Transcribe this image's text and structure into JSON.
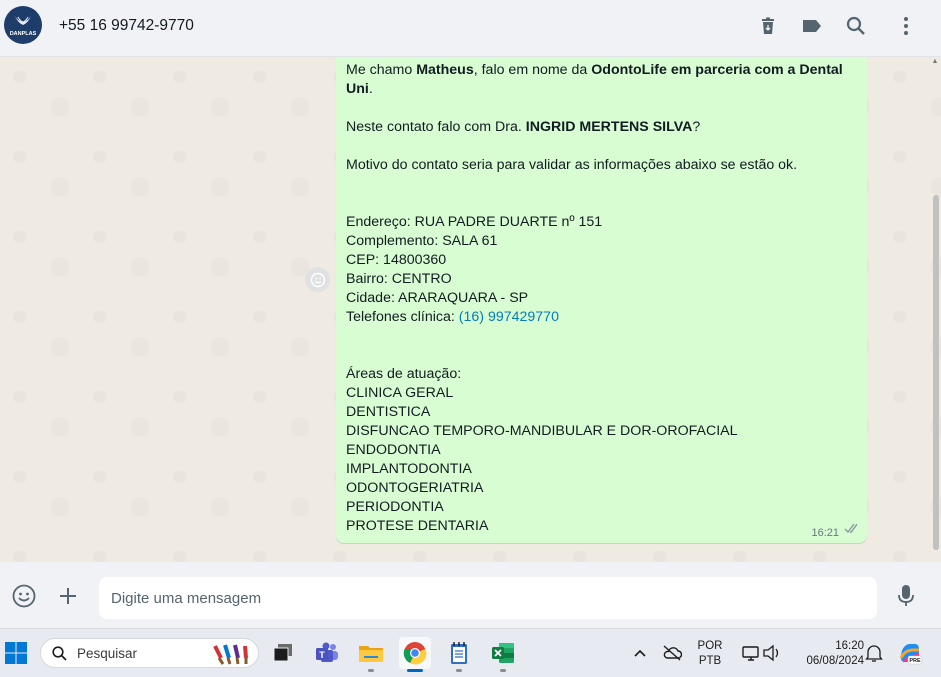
{
  "header": {
    "contact_name": "+55 16 99742-9770",
    "avatar_text": "DANPLAS",
    "icons": [
      "delete-icon",
      "label-icon",
      "search-icon",
      "menu-icon"
    ]
  },
  "message": {
    "intro_prefix": "Me chamo ",
    "intro_name": "Matheus",
    "intro_mid": ", falo em nome da ",
    "intro_company": "OdontoLife em parceria com a Dental Uni",
    "intro_end": ".",
    "contact_prefix": "Neste contato falo com Dra. ",
    "contact_doctor": "INGRID MERTENS SILVA",
    "contact_end": "?",
    "motive": "Motivo do contato seria para validar as informações abaixo se estão ok.",
    "address": "Endereço: RUA PADRE DUARTE nº 151",
    "complement": "Complemento: SALA 61",
    "cep": "CEP: 14800360",
    "district": "Bairro: CENTRO",
    "city": "Cidade: ARARAQUARA - SP",
    "phones_label": "Telefones clínica: ",
    "phones_value": "(16) 997429770",
    "areas_title": "Áreas de atuação:",
    "areas": [
      "CLINICA GERAL",
      "DENTISTICA",
      "DISFUNCAO TEMPORO-MANDIBULAR E DOR-OROFACIAL",
      "ENDODONTIA",
      "IMPLANTODONTIA",
      "ODONTOGERIATRIA",
      "PERIODONTIA",
      "PROTESE DENTARIA"
    ],
    "time": "16:21"
  },
  "composer": {
    "placeholder": "Digite uma mensagem"
  },
  "taskbar": {
    "search_label": "Pesquisar",
    "lang_top": "POR",
    "lang_bottom": "PTB",
    "clock_time": "16:20",
    "clock_date": "06/08/2024",
    "copilot_badge": "PRE"
  },
  "colors": {
    "bubble_out": "#d9fdd3",
    "chat_bg": "#efeae2",
    "header_bg": "#f0f2f5",
    "link": "#027eb5",
    "taskbar_active": "#0067c0"
  }
}
